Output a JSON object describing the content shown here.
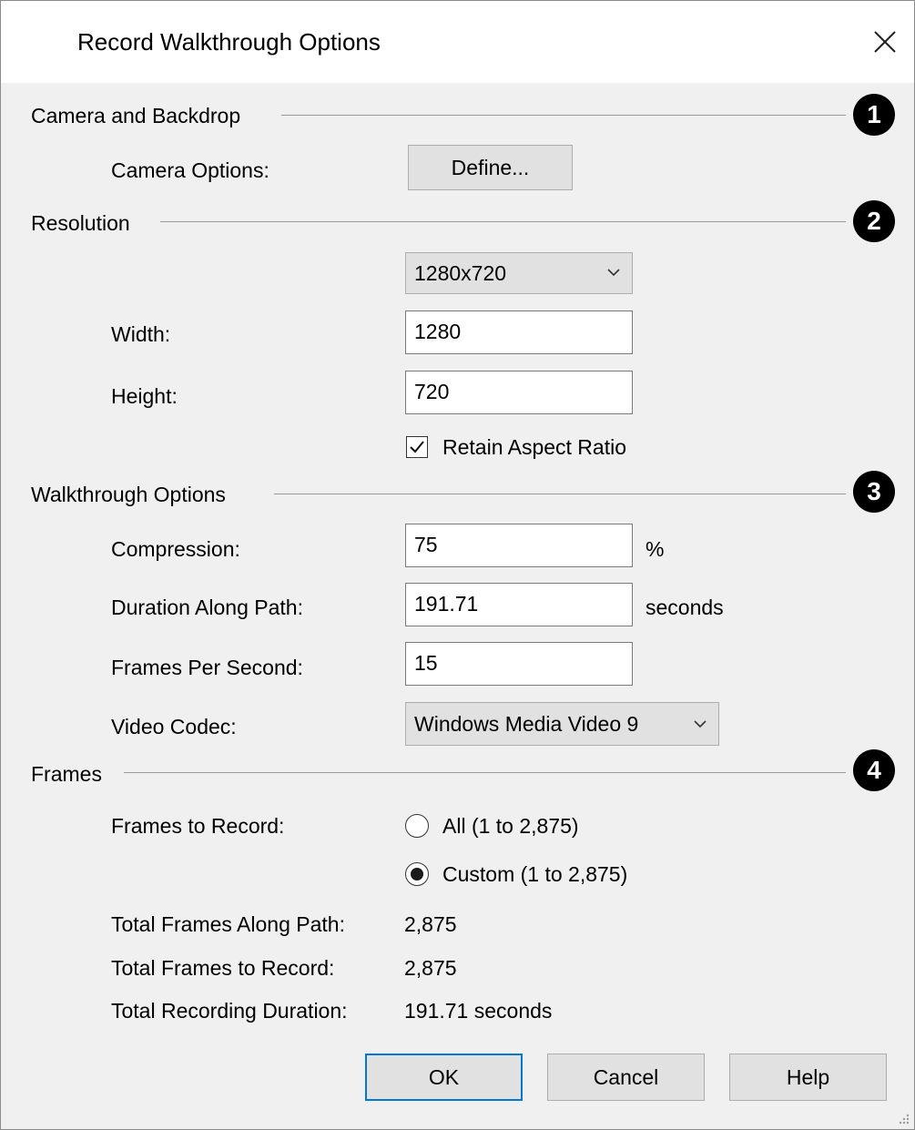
{
  "dialog": {
    "title": "Record Walkthrough Options"
  },
  "sections": {
    "camera": {
      "label": "Camera and Backdrop",
      "badge": "1"
    },
    "resolution": {
      "label": "Resolution",
      "badge": "2"
    },
    "walkthrough": {
      "label": "Walkthrough Options",
      "badge": "3"
    },
    "frames": {
      "label": "Frames",
      "badge": "4"
    }
  },
  "camera": {
    "options_label": "Camera Options:",
    "define_button": "Define..."
  },
  "resolution": {
    "preset": "1280x720",
    "width_label": "Width:",
    "width_value": "1280",
    "height_label": "Height:",
    "height_value": "720",
    "retain_aspect_label": "Retain Aspect Ratio",
    "retain_aspect_checked": true
  },
  "walkthrough": {
    "compression_label": "Compression:",
    "compression_value": "75",
    "compression_unit": "%",
    "duration_label": "Duration Along Path:",
    "duration_value": "191.71",
    "duration_unit": "seconds",
    "fps_label": "Frames Per Second:",
    "fps_value": "15",
    "codec_label": "Video Codec:",
    "codec_value": "Windows Media Video 9"
  },
  "frames": {
    "to_record_label": "Frames to Record:",
    "option_all": "All (1 to 2,875)",
    "option_custom": "Custom (1 to 2,875)",
    "selected": "custom",
    "total_along_path_label": "Total Frames Along Path:",
    "total_along_path_value": "2,875",
    "total_to_record_label": "Total Frames to Record:",
    "total_to_record_value": "2,875",
    "total_duration_label": "Total Recording Duration:",
    "total_duration_value": "191.71 seconds"
  },
  "buttons": {
    "ok": "OK",
    "cancel": "Cancel",
    "help": "Help"
  },
  "colors": {
    "focus_border": "#0078d7",
    "dialog_bg": "#f0f0f0",
    "badge_bg": "#000000"
  },
  "icons": {
    "close": "close-icon",
    "dropdown": "chevron-down-icon",
    "check": "checkmark-icon",
    "grip": "resize-grip-icon"
  }
}
